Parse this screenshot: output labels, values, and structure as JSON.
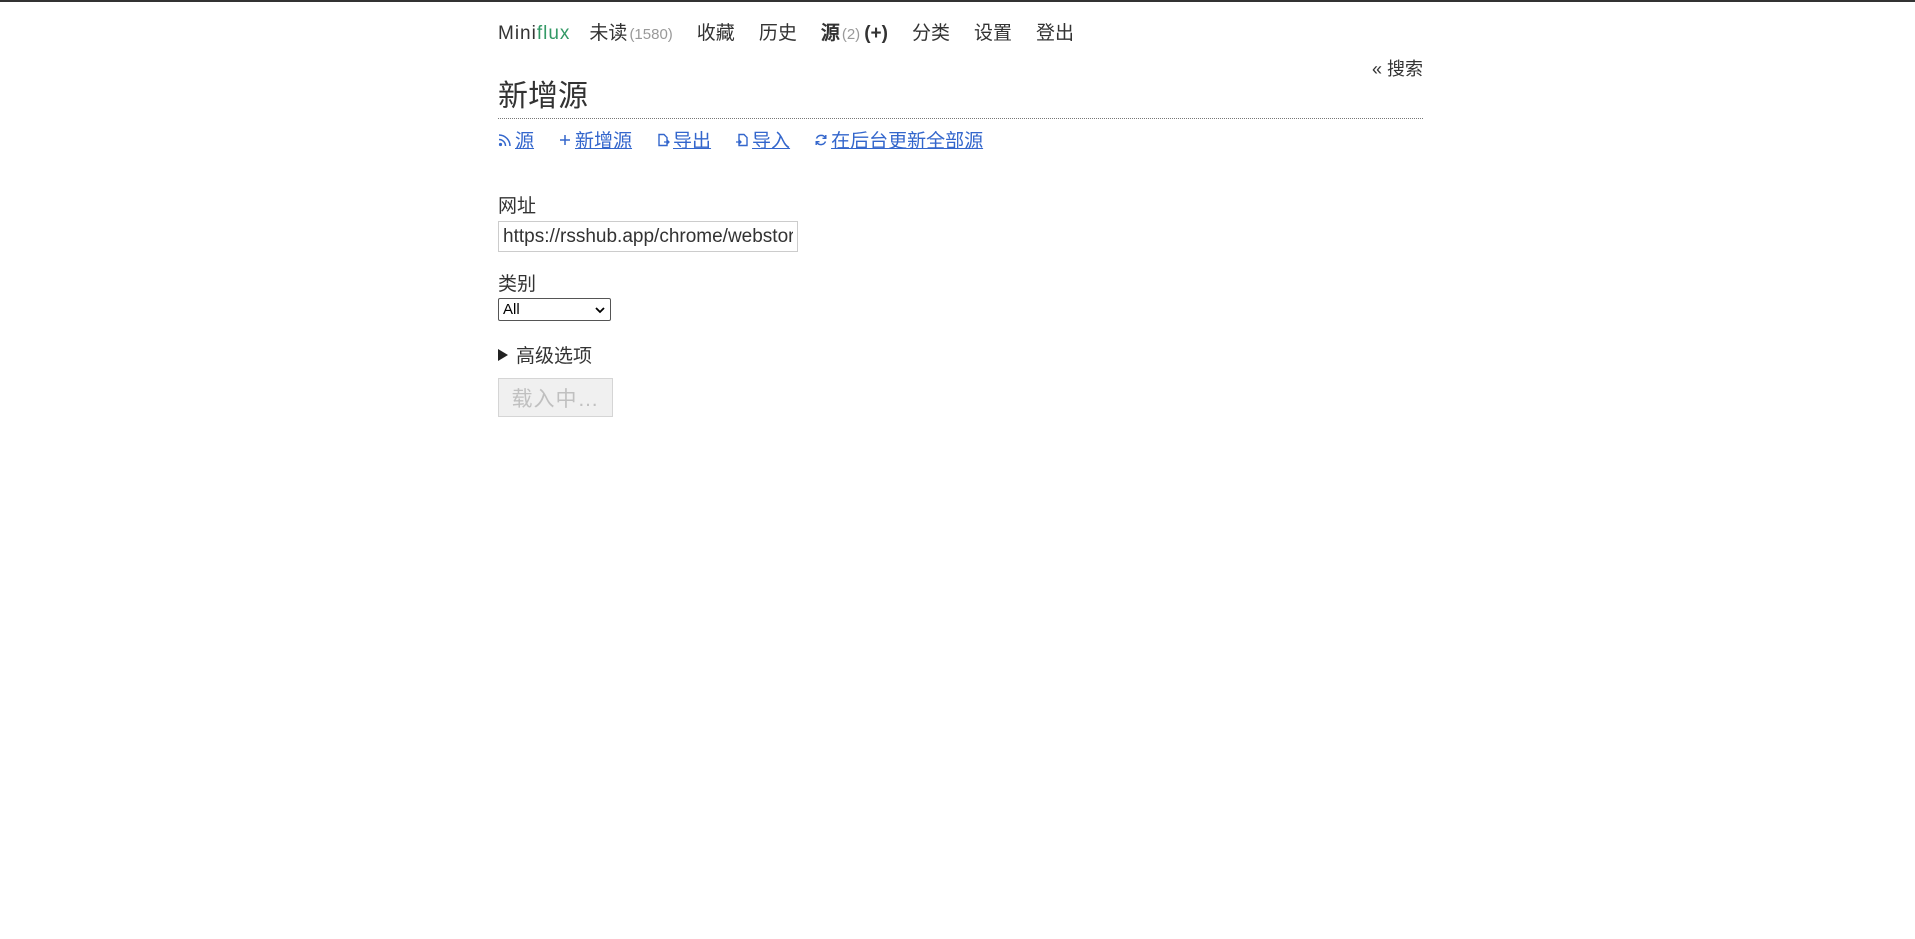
{
  "header": {
    "logo_mini": "Mini",
    "logo_flux": "flux",
    "nav": [
      {
        "label": "未读",
        "count": "(1580)"
      },
      {
        "label": "收藏"
      },
      {
        "label": "历史"
      },
      {
        "label": "源",
        "count": "(2)",
        "add": "(+)"
      },
      {
        "label": "分类"
      },
      {
        "label": "设置"
      },
      {
        "label": "登出"
      }
    ]
  },
  "search_link": "« 搜索",
  "page_title": "新增源",
  "submenu": [
    {
      "icon": "rss-icon",
      "label": "源"
    },
    {
      "icon": "plus-icon",
      "label": "新增源"
    },
    {
      "icon": "export-icon",
      "label": "导出"
    },
    {
      "icon": "import-icon",
      "label": "导入"
    },
    {
      "icon": "refresh-icon",
      "label": "在后台更新全部源"
    }
  ],
  "form": {
    "url_label": "网址",
    "url_value": "https://rsshub.app/chrome/webstore/items/",
    "category_label": "类别",
    "category_selected": "All",
    "advanced_label": "高级选项",
    "submit_label": "载入中…"
  },
  "colors": {
    "link": "#3366cc",
    "brand_green": "#339966",
    "text": "#333333"
  }
}
